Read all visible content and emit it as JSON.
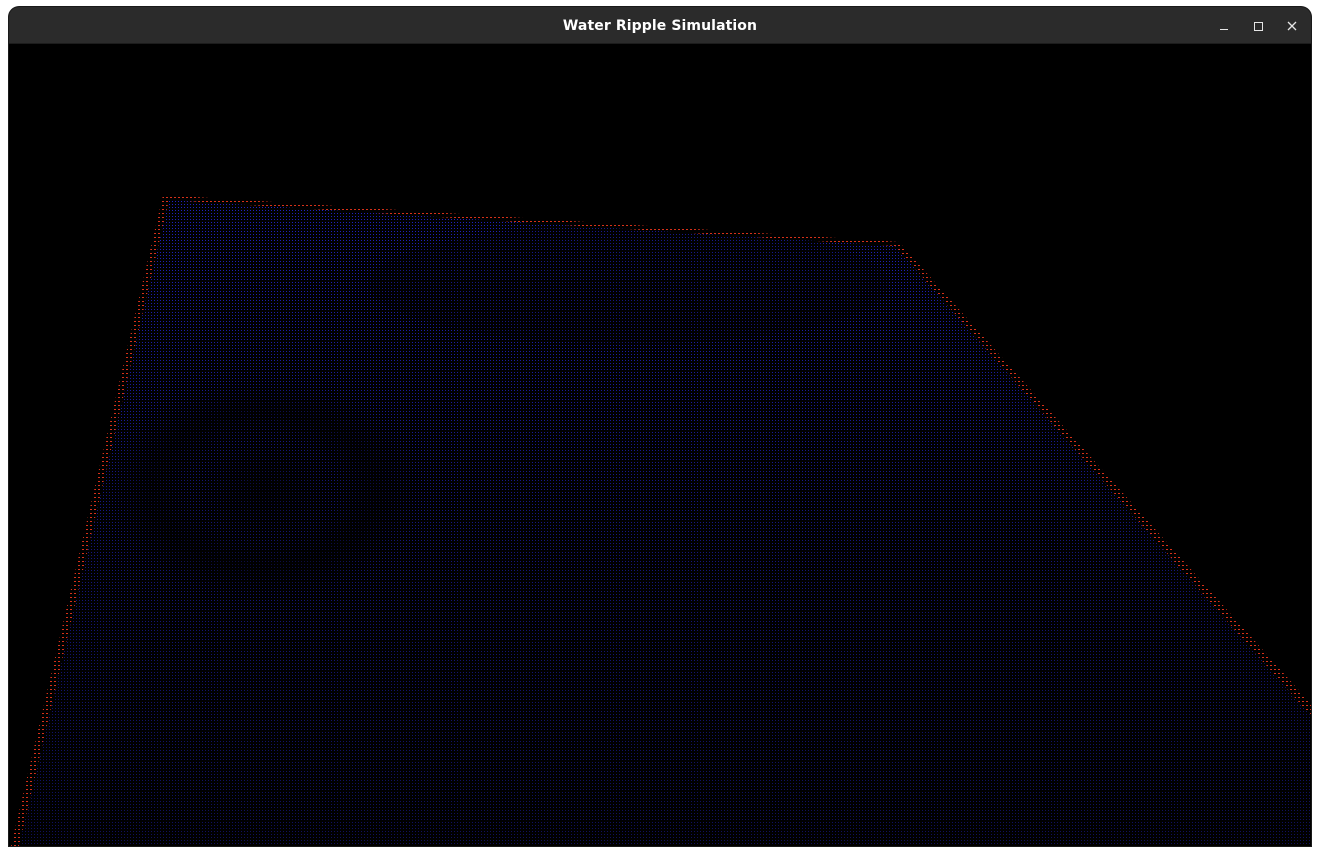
{
  "window": {
    "title": "Water Ripple Simulation"
  },
  "controls": {
    "minimize_icon": "minimize-icon",
    "maximize_icon": "maximize-icon",
    "close_icon": "close-icon"
  },
  "colors": {
    "titlebar": "#2b2b2b",
    "title_text": "#ffffff",
    "background": "#000000",
    "water_points": "#2a2cff",
    "border_points": "#e0341a"
  }
}
